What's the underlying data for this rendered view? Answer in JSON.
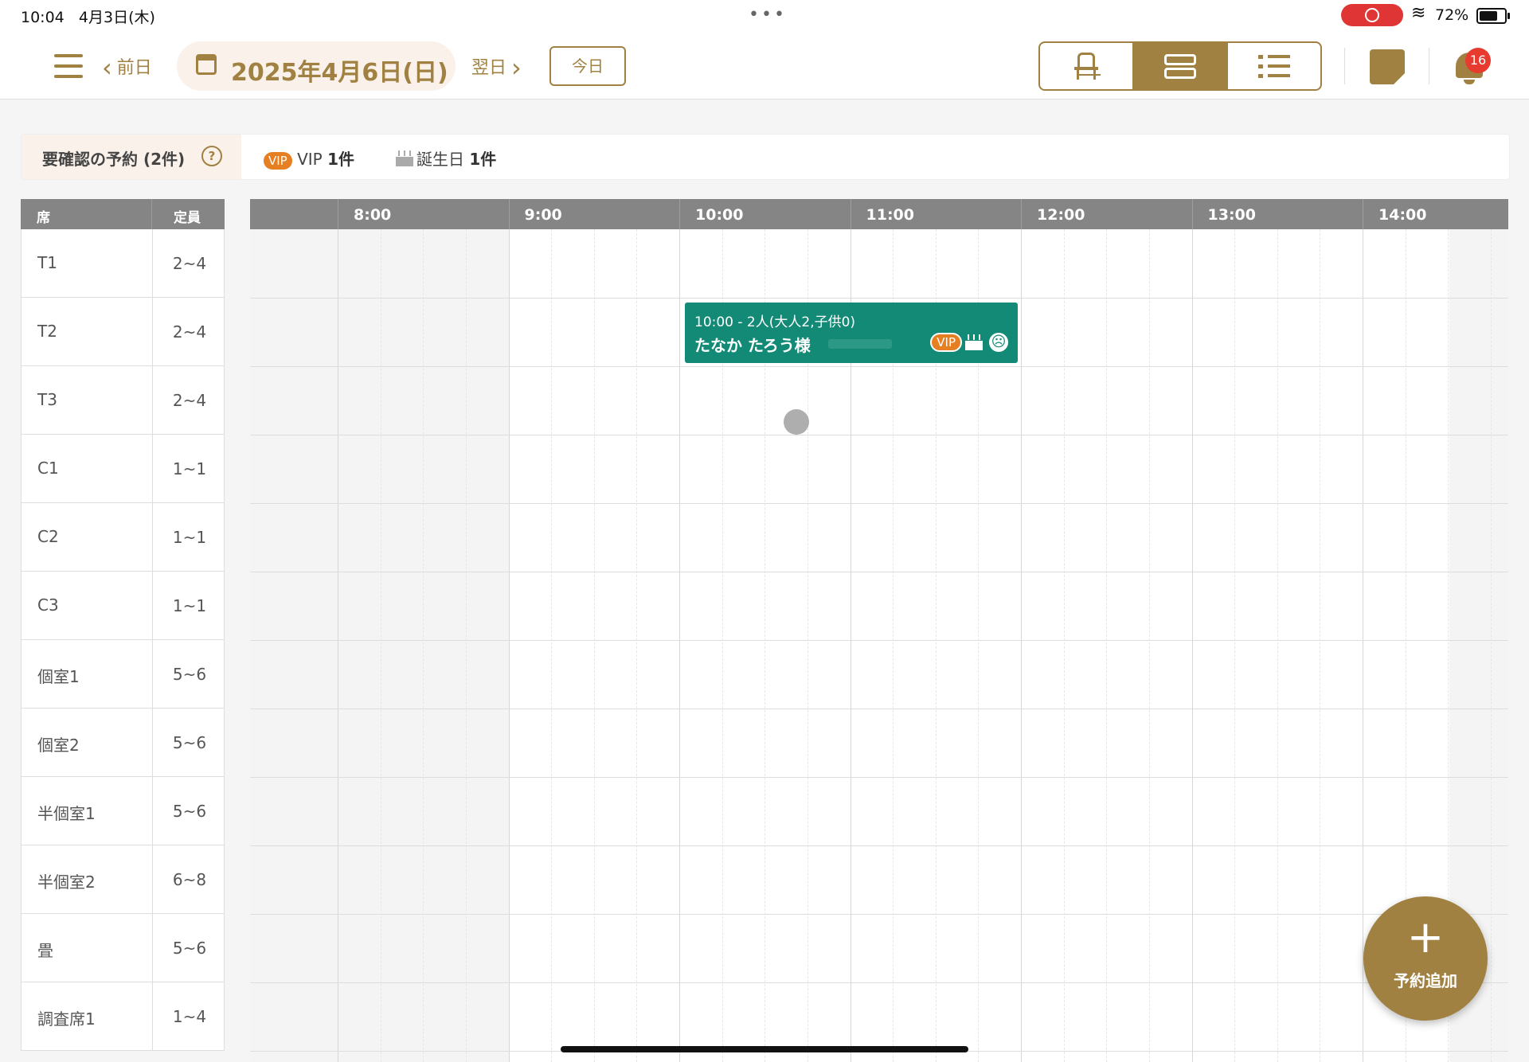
{
  "status_bar": {
    "time": "10:04",
    "date": "4月3日(木)",
    "dots": "•••",
    "battery": "72%"
  },
  "header": {
    "prev_label": "前日",
    "date": "2025年4月6日(日)",
    "next_label": "翌日",
    "today_label": "今日",
    "view_modes": [
      "seat-view",
      "timeline-view",
      "list-view"
    ],
    "active_view": "timeline-view",
    "notification_count": "16"
  },
  "alert_bar": {
    "title": "要確認の予約 (2件)",
    "help": "?",
    "vip_tag": "VIP",
    "vip_label": "VIP",
    "vip_count": "1件",
    "birthday_label": "誕生日",
    "birthday_count": "1件"
  },
  "seat_table": {
    "col_seat": "席",
    "col_capacity": "定員",
    "rows": [
      {
        "name": "T1",
        "cap": "2~4"
      },
      {
        "name": "T2",
        "cap": "2~4"
      },
      {
        "name": "T3",
        "cap": "2~4"
      },
      {
        "name": "C1",
        "cap": "1~1"
      },
      {
        "name": "C2",
        "cap": "1~1"
      },
      {
        "name": "C3",
        "cap": "1~1"
      },
      {
        "name": "個室1",
        "cap": "5~6"
      },
      {
        "name": "個室2",
        "cap": "5~6"
      },
      {
        "name": "半個室1",
        "cap": "5~6"
      },
      {
        "name": "半個室2",
        "cap": "6~8"
      },
      {
        "name": "畳",
        "cap": "5~6"
      },
      {
        "name": "調査席1",
        "cap": "1~4"
      }
    ]
  },
  "timeline": {
    "hours": [
      "8:00",
      "9:00",
      "10:00",
      "11:00",
      "12:00",
      "13:00",
      "14:00"
    ]
  },
  "reservation": {
    "line1": "10:00 - 2人(大人2,子供0)",
    "guest": "たなか たろう様",
    "vip_tag": "VIP",
    "mood_icon": "☹"
  },
  "fab": {
    "plus": "+",
    "label": "予約追加"
  },
  "colors": {
    "accent": "#a08142",
    "reservation": "#138a76",
    "vip": "#e67e22",
    "badge": "#e63b2e"
  }
}
